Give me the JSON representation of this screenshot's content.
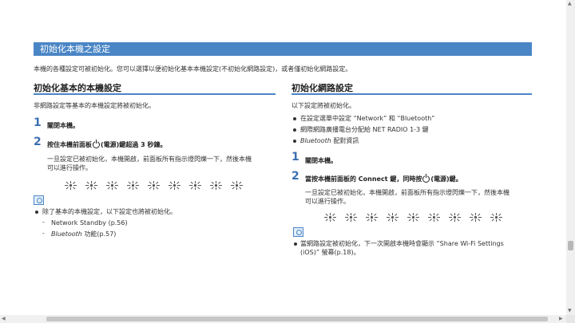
{
  "section_title": "初始化本機之設定",
  "intro": "本機的各種設定可被初始化。您可以選擇以便初始化基本本機設定(不初始化網路設定)，或者僅初始化網路設定。",
  "left": {
    "title": "初始化基本的本機設定",
    "desc": "非網路設定等基本的本機設定將被初始化。",
    "step1_num": "1",
    "step1_text": "關閉本機。",
    "step2_num": "2",
    "step2_text_a": "按住本機前面板",
    "step2_text_b": "(電源)鍵超過 3 秒鐘。",
    "step2_detail_1": "一旦設定已被初始化，本機開啟，前面板所有指示燈閃爍一下，然後本機",
    "step2_detail_2": "可以進行操作。",
    "note_bullet": "除了基本的本機設定，以下設定也將被初始化。",
    "sub1": "Network Standby (p.56)",
    "sub2_italic": "Bluetooth",
    "sub2_rest": " 功能(p.57)"
  },
  "right": {
    "title": "初始化網路設定",
    "desc": "以下設定將被初始化。",
    "bullet1": "在設定選單中設定 “Network” 和 “Bluetooth”",
    "bullet2": "網際網路廣播電台分配給 NET RADIO 1-3 鍵",
    "bullet3_italic": "Bluetooth",
    "bullet3_rest": " 配對資訊",
    "step1_num": "1",
    "step1_text": "關閉本機。",
    "step2_num": "2",
    "step2_text_a": "當按本機前面板的 Connect 鍵，同時按",
    "step2_text_b": "(電源)鍵。",
    "step2_detail_1": "一旦設定已被初始化，本機開啟，前面板所有指示燈閃爍一下，然後本機",
    "step2_detail_2": "可以進行操作。",
    "note_line1": "當網路設定被初始化，下一次開啟本機時會顯示 “Share Wi-Fi Settings",
    "note_line2": "(iOS)” 螢幕(p.18)。"
  },
  "icons": [
    "power-icon",
    "led-blink-icon",
    "note-icon"
  ],
  "colors": {
    "accent": "#4a86c5",
    "step_number": "#3a6fb0"
  }
}
